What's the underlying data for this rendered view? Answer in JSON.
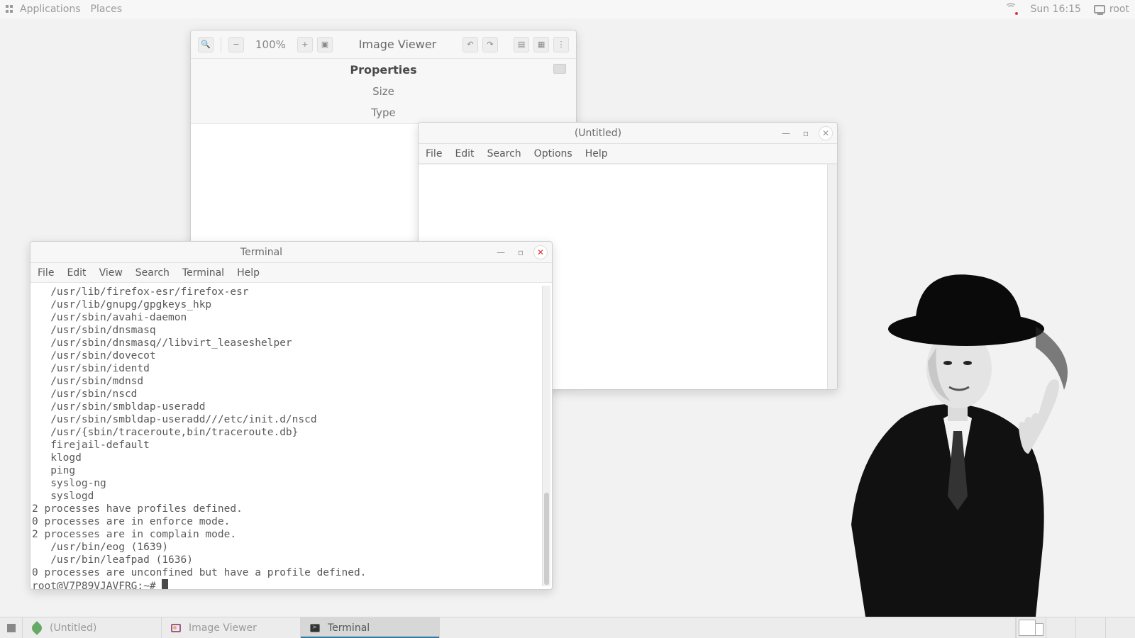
{
  "top_panel": {
    "applications": "Applications",
    "places": "Places",
    "clock": "Sun 16:15",
    "user": "root"
  },
  "taskbar": {
    "items": [
      {
        "label": "(Untitled)",
        "icon": "leaf"
      },
      {
        "label": "Image Viewer",
        "icon": "image"
      },
      {
        "label": "Terminal",
        "icon": "terminal",
        "active": true
      }
    ]
  },
  "image_viewer": {
    "title": "Image Viewer",
    "zoom": "100%",
    "properties": {
      "header": "Properties",
      "size_label": "Size",
      "type_label": "Type"
    }
  },
  "leafpad": {
    "title": "(Untitled)",
    "menus": {
      "file": "File",
      "edit": "Edit",
      "search": "Search",
      "options": "Options",
      "help": "Help"
    }
  },
  "terminal": {
    "title": "Terminal",
    "menus": {
      "file": "File",
      "edit": "Edit",
      "view": "View",
      "search": "Search",
      "terminal": "Terminal",
      "help": "Help"
    },
    "lines": [
      "   /usr/lib/firefox-esr/firefox-esr",
      "   /usr/lib/gnupg/gpgkeys_hkp",
      "   /usr/sbin/avahi-daemon",
      "   /usr/sbin/dnsmasq",
      "   /usr/sbin/dnsmasq//libvirt_leaseshelper",
      "   /usr/sbin/dovecot",
      "   /usr/sbin/identd",
      "   /usr/sbin/mdnsd",
      "   /usr/sbin/nscd",
      "   /usr/sbin/smbldap-useradd",
      "   /usr/sbin/smbldap-useradd///etc/init.d/nscd",
      "   /usr/{sbin/traceroute,bin/traceroute.db}",
      "   firejail-default",
      "   klogd",
      "   ping",
      "   syslog-ng",
      "   syslogd",
      "2 processes have profiles defined.",
      "0 processes are in enforce mode.",
      "2 processes are in complain mode.",
      "   /usr/bin/eog (1639)",
      "   /usr/bin/leafpad (1636)",
      "0 processes are unconfined but have a profile defined."
    ],
    "prompt": "root@V7P89VJAVFRG:~# "
  }
}
